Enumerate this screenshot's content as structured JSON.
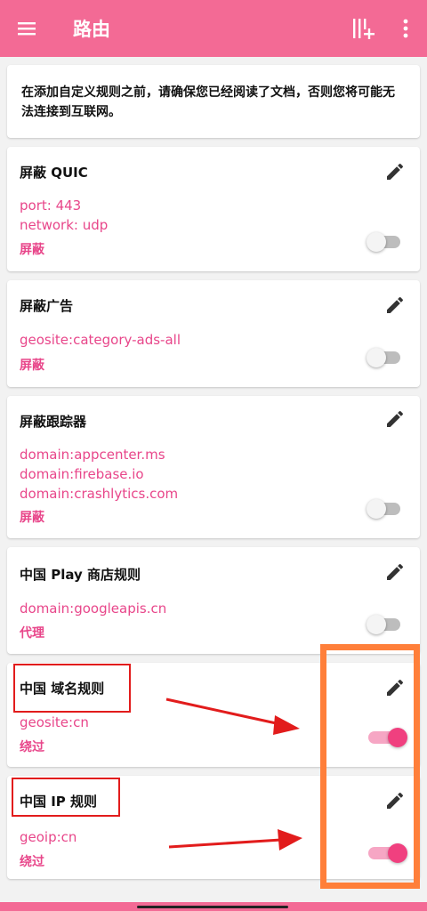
{
  "app": {
    "title": "路由"
  },
  "notice": "在添加自定义规则之前，请确保您已经阅读了文档，否则您将可能无法连接到互联网。",
  "rules": [
    {
      "title": "屏蔽 QUIC",
      "lines": [
        "port: 443",
        "network: udp"
      ],
      "action": "屏蔽",
      "enabled": false
    },
    {
      "title": "屏蔽广告",
      "lines": [
        "geosite:category-ads-all"
      ],
      "action": "屏蔽",
      "enabled": false
    },
    {
      "title": "屏蔽跟踪器",
      "lines": [
        "domain:appcenter.ms",
        "domain:firebase.io",
        "domain:crashlytics.com"
      ],
      "action": "屏蔽",
      "enabled": false
    },
    {
      "title": "中国 Play 商店规则",
      "lines": [
        "domain:googleapis.cn"
      ],
      "action": "代理",
      "enabled": false
    },
    {
      "title": "中国 域名规则",
      "lines": [
        "geosite:cn"
      ],
      "action": "绕过",
      "enabled": true
    },
    {
      "title": "中国 IP 规则",
      "lines": [
        "geoip:cn"
      ],
      "action": "绕过",
      "enabled": true
    }
  ],
  "colors": {
    "primary": "#f36a95",
    "accent": "#e8468a",
    "switch_on": "#f0407f",
    "annotation_red": "#e21c1c",
    "annotation_orange": "#ff7f3a"
  },
  "icons": {
    "menu": "menu-icon",
    "add_rule": "add-rule-icon",
    "more": "more-vert-icon",
    "edit": "pencil-icon"
  }
}
